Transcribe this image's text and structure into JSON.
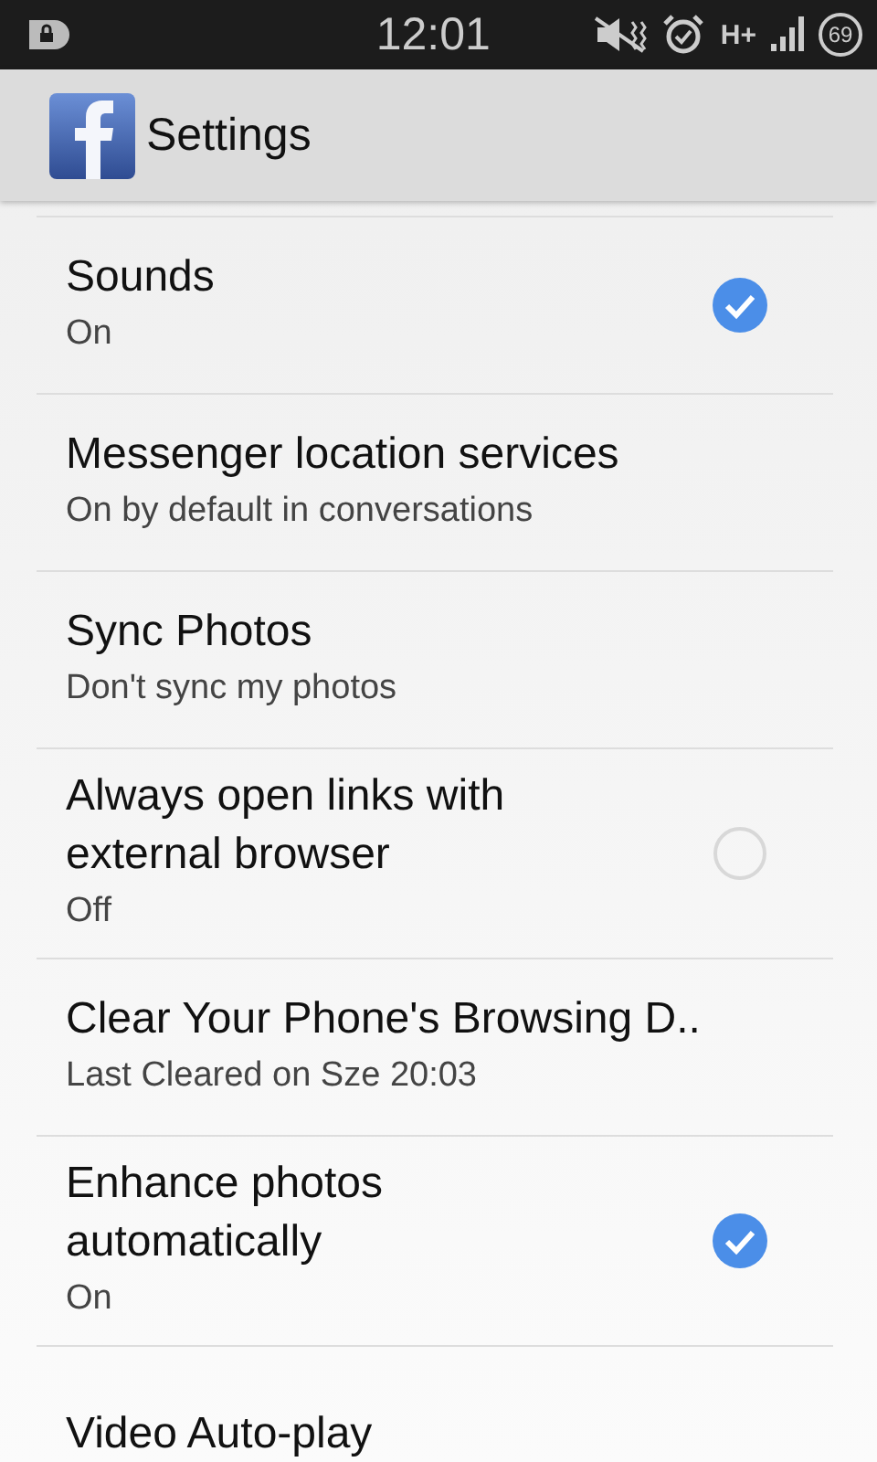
{
  "status_bar": {
    "time": "12:01",
    "network": "H+",
    "battery": "69"
  },
  "action_bar": {
    "title": "Settings"
  },
  "settings": [
    {
      "kind": "check",
      "title": "Sounds",
      "summary": "On",
      "checked": true
    },
    {
      "kind": "plain",
      "title": "Messenger location services",
      "summary": "On by default in conversations"
    },
    {
      "kind": "plain",
      "title": "Sync Photos",
      "summary": "Don't sync my photos"
    },
    {
      "kind": "check",
      "title": "Always open links with external browser",
      "summary": "Off",
      "checked": false
    },
    {
      "kind": "plain",
      "title": "Clear Your Phone's Browsing D..",
      "summary": "Last Cleared on Sze 20:03"
    },
    {
      "kind": "check",
      "title": "Enhance photos automatically",
      "summary": "On",
      "checked": true
    },
    {
      "kind": "plain",
      "title": "Video Auto-play"
    }
  ]
}
